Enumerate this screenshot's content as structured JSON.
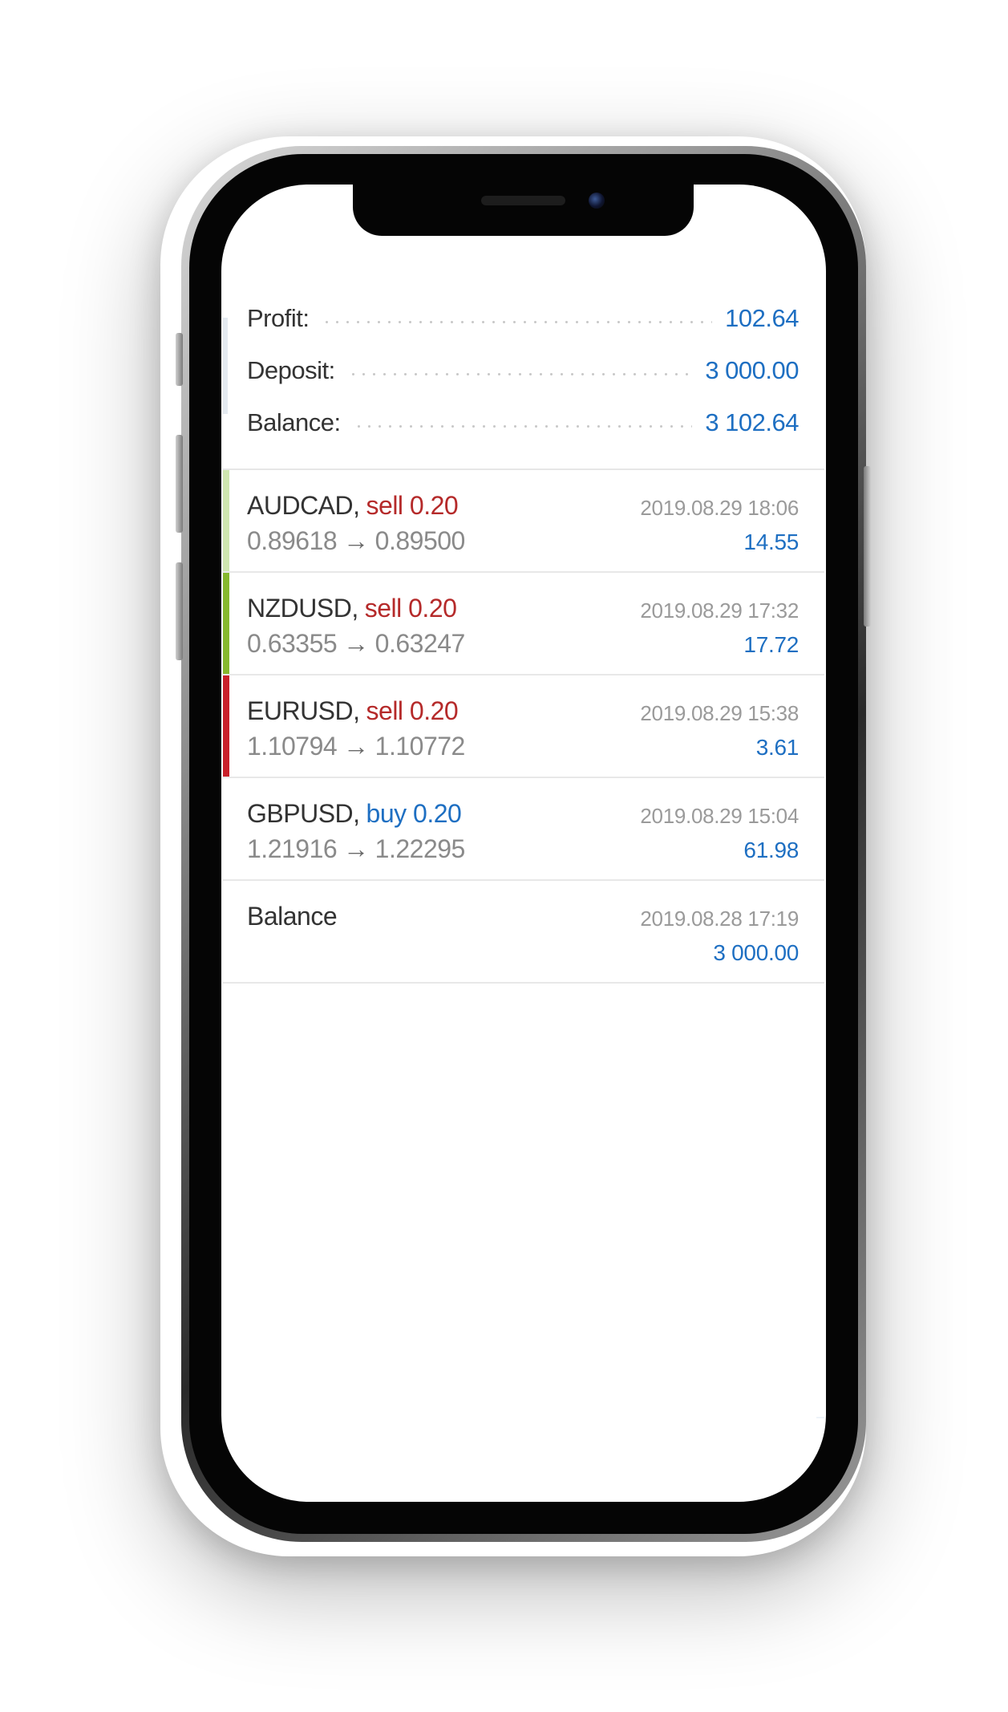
{
  "summary": {
    "profit_label": "Profit:",
    "profit_value": "102.64",
    "deposit_label": "Deposit:",
    "deposit_value": "3 000.00",
    "balance_label": "Balance:",
    "balance_value": "3 102.64"
  },
  "trades": [
    {
      "symbol": "AUDCAD",
      "side": "sell",
      "volume": "0.20",
      "open_price": "0.89618",
      "close_price": "0.89500",
      "time": "2019.08.29 18:06",
      "profit": "14.55",
      "accent_color": "#cfe6b0"
    },
    {
      "symbol": "NZDUSD",
      "side": "sell",
      "volume": "0.20",
      "open_price": "0.63355",
      "close_price": "0.63247",
      "time": "2019.08.29 17:32",
      "profit": "17.72",
      "accent_color": "#86b82d"
    },
    {
      "symbol": "EURUSD",
      "side": "sell",
      "volume": "0.20",
      "open_price": "1.10794",
      "close_price": "1.10772",
      "time": "2019.08.29 15:38",
      "profit": "3.61",
      "accent_color": "#c8202a"
    },
    {
      "symbol": "GBPUSD",
      "side": "buy",
      "volume": "0.20",
      "open_price": "1.21916",
      "close_price": "1.22295",
      "time": "2019.08.29 15:04",
      "profit": "61.98",
      "accent_color": "#ffffff"
    }
  ],
  "balance_entry": {
    "label": "Balance",
    "time": "2019.08.28 17:19",
    "amount": "3 000.00"
  },
  "arrow_glyph": "→",
  "comma": ",",
  "colors": {
    "value_blue": "#1e6fc2",
    "sell_red": "#b52a2a",
    "buy_blue": "#1e6fc2"
  }
}
